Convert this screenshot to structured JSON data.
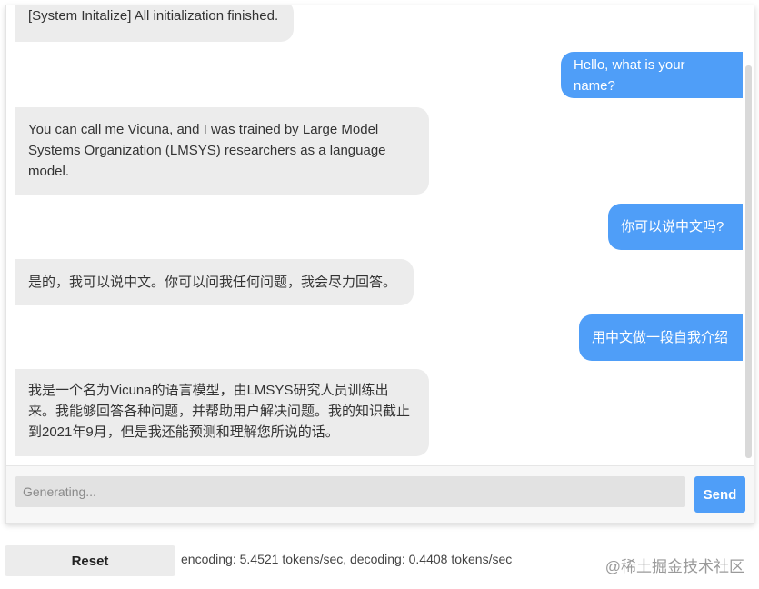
{
  "messages": [
    {
      "role": "bot",
      "lines": [
        "[System Initalize] All initialization finished."
      ]
    },
    {
      "role": "user",
      "lines": [
        "Hello, what is your name?"
      ]
    },
    {
      "role": "bot",
      "lines": [
        "You can call me Vicuna, and I was trained by Large Model",
        "Systems Organization (LMSYS) researchers as a language",
        "model."
      ]
    },
    {
      "role": "user",
      "lines": [
        "你可以说中文吗?"
      ]
    },
    {
      "role": "bot",
      "lines": [
        "是的，我可以说中文。你可以问我任何问题，我会尽力回答。"
      ]
    },
    {
      "role": "user",
      "lines": [
        "用中文做一段自我介绍"
      ]
    },
    {
      "role": "bot",
      "lines": [
        "我是一个名为Vicuna的语言模型，由LMSYS研究人员训练出",
        "来。我能够回答各种问题，并帮助用户解决问题。我的知识截止",
        "到2021年9月，但是我还能预测和理解您所说的话。"
      ]
    }
  ],
  "input": {
    "placeholder": "Generating..."
  },
  "send_label": "Send",
  "reset_label": "Reset",
  "stats": "encoding: 5.4521 tokens/sec, decoding: 0.4408 tokens/sec",
  "watermark": "@稀土掘金技术社区",
  "colors": {
    "accent": "#4f9ef8",
    "bot_bubble": "#ececec"
  }
}
